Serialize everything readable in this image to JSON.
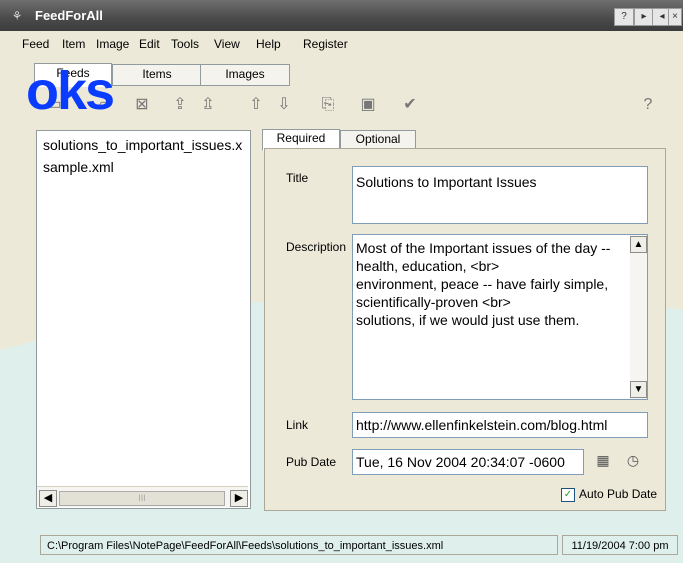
{
  "window": {
    "title": "FeedForAll",
    "buttons": [
      "?",
      "▸",
      "◂",
      "×"
    ]
  },
  "menu": [
    "Feed",
    "Item",
    "Image",
    "Edit",
    "Tools",
    "View",
    "Help",
    "Register"
  ],
  "main_tabs": [
    "Feeds",
    "Items",
    "Images"
  ],
  "watermark": "oks",
  "toolbar_icons": [
    "new-feed-icon",
    "open-folder-icon",
    "save-icon",
    "close-feed-icon",
    "publish-icon",
    "upload-icon",
    "move-up-icon",
    "move-down-icon",
    "preview-icon",
    "gallery-icon",
    "validate-icon",
    "help-icon"
  ],
  "files": [
    "solutions_to_important_issues.x",
    "sample.xml"
  ],
  "scroll": {
    "thumb_label": "III"
  },
  "sub_tabs": [
    "Required",
    "Optional"
  ],
  "form": {
    "title_label": "Title",
    "title_value": "Solutions to Important Issues",
    "description_label": "Description",
    "description_lines": [
      "Most of the Important issues of the day --",
      "health, education, <br>",
      "environment, peace -- have fairly simple,",
      "scientifically-proven <br>",
      "solutions, if we would just use them."
    ],
    "link_label": "Link",
    "link_value": "http://www.ellenfinkelstein.com/blog.html",
    "pubdate_label": "Pub Date",
    "pubdate_value": "Tue, 16 Nov 2004 20:34:07 -0600",
    "auto_pub_label": "Auto Pub Date",
    "auto_pub_checked": true
  },
  "status": {
    "path": "C:\\Program Files\\NotePage\\FeedForAll\\Feeds\\solutions_to_important_issues.xml",
    "datetime": "11/19/2004 7:00 pm"
  },
  "colors": {
    "watermark": "#0a3cff",
    "background_curve": "#cfeef3",
    "title_bar": "#4a4a4a"
  }
}
